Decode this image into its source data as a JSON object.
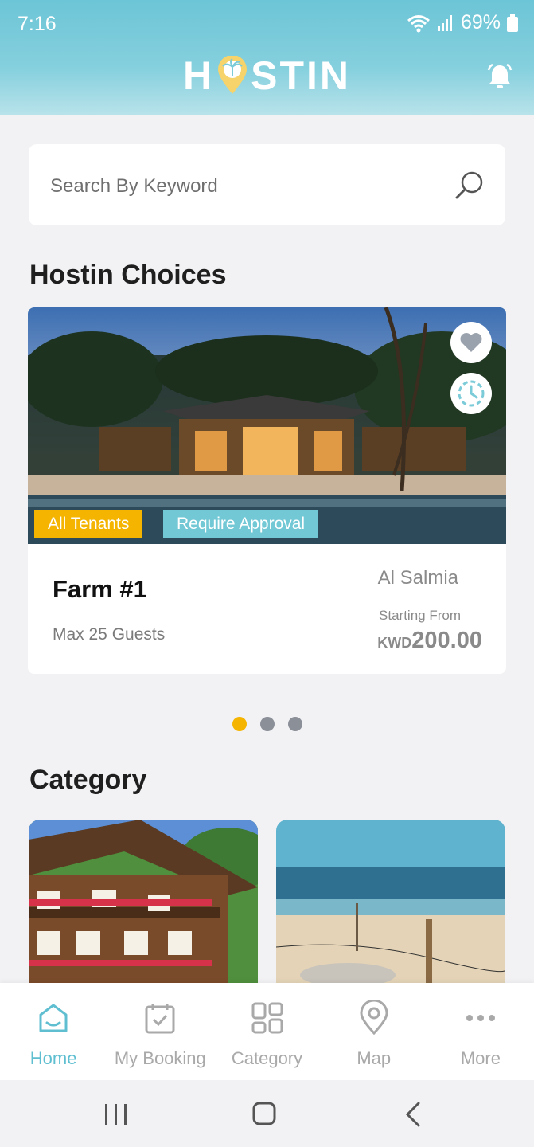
{
  "status_bar": {
    "time": "7:16",
    "battery": "69%"
  },
  "header": {
    "logo_h": "H",
    "logo_rest": "STIN"
  },
  "search": {
    "placeholder": "Search By Keyword"
  },
  "choices": {
    "title": "Hostin Choices",
    "cards": [
      {
        "name": "Farm #1",
        "guests": "Max 25 Guests",
        "location": "Al Salmia",
        "price_prefix": "Starting From",
        "currency": "KWD",
        "price": "200.00",
        "tags": [
          "All Tenants",
          "Require Approval"
        ]
      }
    ],
    "carousel": {
      "count": 3,
      "active_index": 0
    }
  },
  "category": {
    "title": "Category"
  },
  "bottom_nav": {
    "items": [
      {
        "label": "Home",
        "icon": "home-icon",
        "active": true
      },
      {
        "label": "My Booking",
        "icon": "calendar-check-icon"
      },
      {
        "label": "Category",
        "icon": "grid-icon"
      },
      {
        "label": "Map",
        "icon": "map-pin-icon"
      },
      {
        "label": "More",
        "icon": "more-dots-icon"
      }
    ]
  },
  "colors": {
    "accent": "#5fbfd1",
    "header": "#6cc5d6",
    "tag_yellow": "#f4b400",
    "tag_blue": "#73c8d6"
  }
}
